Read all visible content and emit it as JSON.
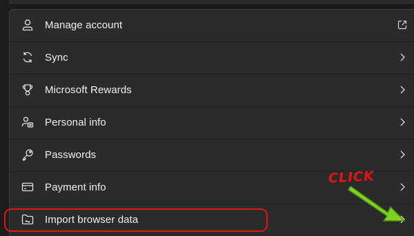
{
  "menu": {
    "items": [
      {
        "label": "Manage account",
        "icon": "person-icon",
        "trailing": "external-link-icon"
      },
      {
        "label": "Sync",
        "icon": "sync-icon",
        "trailing": "chevron-right-icon"
      },
      {
        "label": "Microsoft Rewards",
        "icon": "trophy-icon",
        "trailing": "chevron-right-icon"
      },
      {
        "label": "Personal info",
        "icon": "contact-card-icon",
        "trailing": "chevron-right-icon"
      },
      {
        "label": "Passwords",
        "icon": "key-icon",
        "trailing": "chevron-right-icon"
      },
      {
        "label": "Payment info",
        "icon": "credit-card-icon",
        "trailing": "chevron-right-icon"
      },
      {
        "label": "Import browser data",
        "icon": "folder-import-icon",
        "trailing": "chevron-right-icon"
      }
    ]
  },
  "annotation": {
    "callout_text": "CLICK",
    "highlight_color": "#e01717",
    "arrow_color": "#7ed321"
  },
  "colors": {
    "panel_background": "#2b2b2b",
    "page_background": "#1c1c1c",
    "text": "#f2f2f2"
  }
}
